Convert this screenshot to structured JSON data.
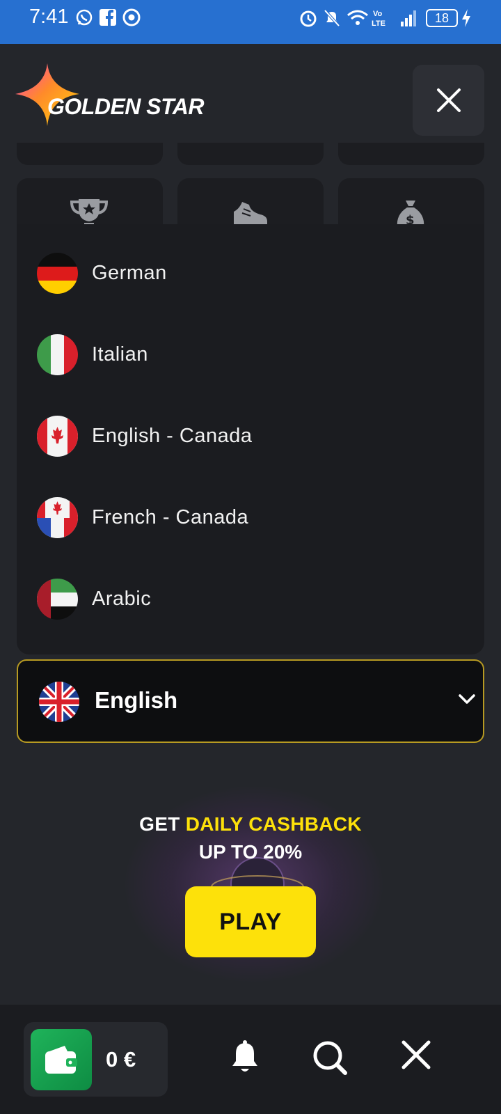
{
  "status_bar": {
    "time": "7:41",
    "battery": "18",
    "icons": [
      "whatsapp-icon",
      "facebook-icon",
      "chrome-icon",
      "alarm-icon",
      "bell-off-icon",
      "wifi-icon",
      "volte-icon",
      "signal-icon",
      "battery-icon",
      "charging-icon"
    ]
  },
  "header": {
    "logo_text": "GOLDEN STAR",
    "close_icon": "close-icon"
  },
  "grid_tiles": {
    "icons": [
      "trophy-icon",
      "sneaker-icon",
      "money-bag-icon"
    ]
  },
  "language_menu": {
    "items": [
      {
        "label": "German",
        "flag": "de"
      },
      {
        "label": "Italian",
        "flag": "it"
      },
      {
        "label": "English - Canada",
        "flag": "ca"
      },
      {
        "label": "French - Canada",
        "flag": "ca-fr"
      },
      {
        "label": "Arabic",
        "flag": "ae"
      }
    ],
    "selected": {
      "label": "English",
      "flag": "gb"
    }
  },
  "promo": {
    "line1_prefix": "GET ",
    "line1_highlight": "DAILY CASHBACK",
    "line2": "UP TO 20%",
    "button_label": "PLAY"
  },
  "bottom_bar": {
    "balance": "0 €",
    "icons": [
      "wallet-icon",
      "bell-icon",
      "search-icon",
      "close-icon"
    ]
  },
  "colors": {
    "accent_yellow": "#fde10a",
    "selector_border": "#b79a22",
    "background": "#24262b",
    "status_bar": "#2770d0",
    "wallet_green": "#1fb35a"
  }
}
